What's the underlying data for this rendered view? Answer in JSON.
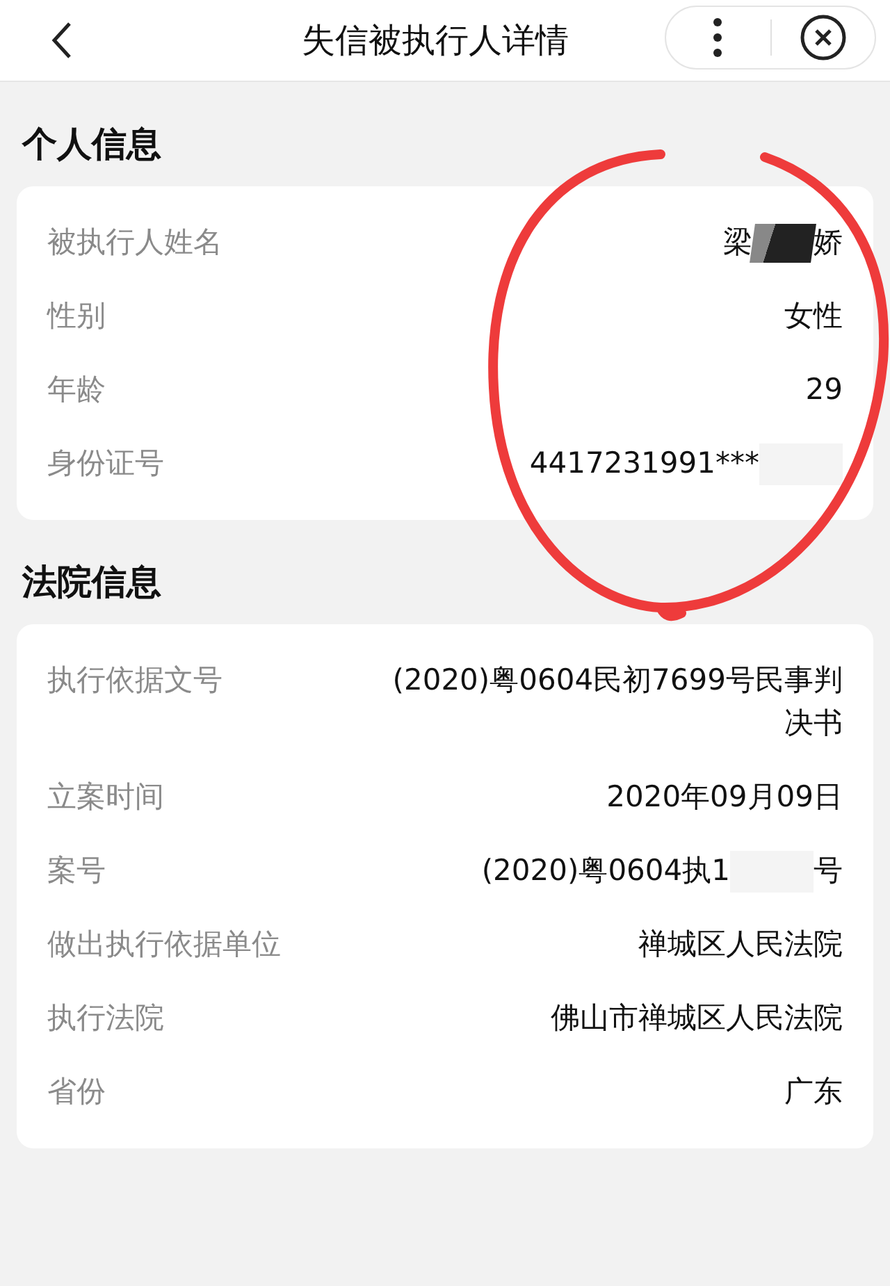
{
  "nav_bar": {
    "title": "失信被执行人详情"
  },
  "sections": [
    {
      "title": "个人信息",
      "annotated": true,
      "rows": [
        {
          "kind": "blocked",
          "label": "被执行人姓名",
          "value": "梁",
          "value_end": "娇"
        },
        {
          "kind": "plain",
          "label": "性别",
          "value": "女性"
        },
        {
          "kind": "plain",
          "label": "年龄",
          "value": "29"
        },
        {
          "kind": "blurred",
          "label": "身份证号",
          "value": "4417231991***"
        }
      ]
    },
    {
      "title": "法院信息",
      "rows": [
        {
          "kind": "plain",
          "label": "执行依据文号",
          "value": "(2020)粤0604民初7699号民事判决书"
        },
        {
          "kind": "plain",
          "label": "立案时间",
          "value": "2020年09月09日"
        },
        {
          "kind": "blurred",
          "label": "案号",
          "value": "(2020)粤0604执1",
          "value_end": "号"
        },
        {
          "kind": "plain",
          "label": "做出执行依据单位",
          "value": "禅城区人民法院"
        },
        {
          "kind": "plain",
          "label": "执行法院",
          "value": "佛山市禅城区人民法院"
        },
        {
          "kind": "plain",
          "label": "省份",
          "value": "广东"
        }
      ]
    }
  ]
}
